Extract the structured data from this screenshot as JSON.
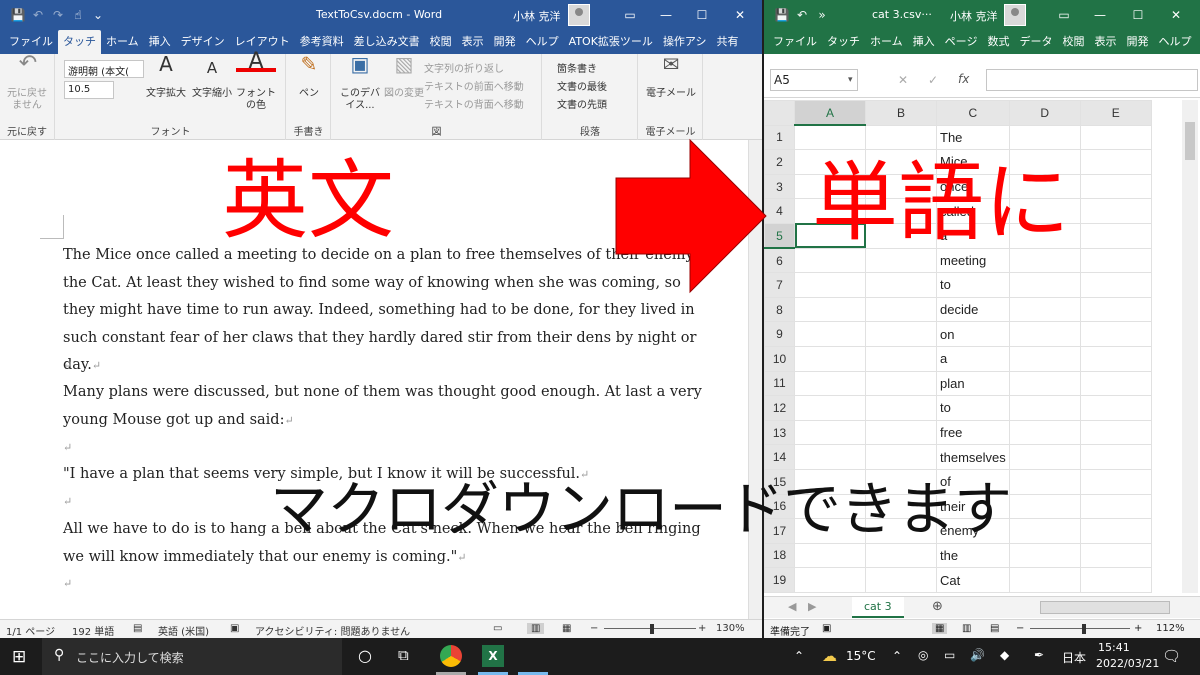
{
  "word": {
    "title": "TextToCsv.docm  -  Word",
    "user": "小林 克洋",
    "tabs": [
      "ファイル",
      "タッチ",
      "ホーム",
      "挿入",
      "デザイン",
      "レイアウト",
      "参考資料",
      "差し込み文書",
      "校閲",
      "表示",
      "開発",
      "ヘルプ",
      "ATOK拡張ツール",
      "操作アシ",
      "共有"
    ],
    "active_tab": "タッチ",
    "ribbon": {
      "undo_label": "元に戻せ\nません",
      "undo_group": "元に戻す",
      "font_name": "游明朝 (本文(",
      "font_size": "10.5",
      "grow_font": "文字拡大",
      "shrink_font": "文字縮小",
      "font_color": "フォント\nの色",
      "font_group": "フォント",
      "pen": "ペン",
      "handwriting_group": "手書き",
      "device_btn": "このデバ\nイス...",
      "change_pic": "図の変更",
      "wrap_text": "文字列の折り返し",
      "bring_front": "テキストの前面へ移動",
      "send_back": "テキストの背面へ移動",
      "picture_group": "図",
      "bullets": "箇条書き",
      "doc_end": "文書の最後",
      "doc_start": "文書の先頭",
      "paragraph_group": "段落",
      "email": "電子メール",
      "email_group": "電子メール"
    },
    "paragraphs": [
      "The Mice once called a meeting to decide on a plan to free themselves of their enemy, the Cat. At least they wished to find some way of knowing when she was coming, so they might have time to run away. Indeed, something had to be done, for they lived in such constant fear of her claws that they hardly dared stir from their dens by night or day.",
      "",
      "Many plans were discussed, but none of them was thought good enough. At last a very young Mouse got up and said:",
      "",
      "\"I have a plan that seems very simple, but I know it will be successful.",
      "",
      "All we have to do is to hang a bell about the Cat's neck. When we hear the bell ringing we will know immediately that our enemy is coming.\"",
      ""
    ],
    "status": {
      "page": "1/1 ページ",
      "words": "192 単語",
      "lang": "英語 (米国)",
      "access": "アクセシビリティ: 問題ありません",
      "zoom": "130%"
    }
  },
  "excel": {
    "title": "cat 3.csv···",
    "user": "小林 克洋",
    "tabs": [
      "ファイル",
      "タッチ",
      "ホーム",
      "挿入",
      "ページ",
      "数式",
      "データ",
      "校閲",
      "表示",
      "開発",
      "ヘルプ",
      "操作ア"
    ],
    "name_box": "A5",
    "columns": [
      "A",
      "B",
      "C",
      "D",
      "E"
    ],
    "rows": [
      {
        "n": "1",
        "c": "The"
      },
      {
        "n": "2",
        "c": "Mice"
      },
      {
        "n": "3",
        "c": "once"
      },
      {
        "n": "4",
        "c": "called"
      },
      {
        "n": "5",
        "c": "a"
      },
      {
        "n": "6",
        "c": "meeting"
      },
      {
        "n": "7",
        "c": "to"
      },
      {
        "n": "8",
        "c": "decide"
      },
      {
        "n": "9",
        "c": "on"
      },
      {
        "n": "10",
        "c": "a"
      },
      {
        "n": "11",
        "c": "plan"
      },
      {
        "n": "12",
        "c": "to"
      },
      {
        "n": "13",
        "c": "free"
      },
      {
        "n": "14",
        "c": "themselves"
      },
      {
        "n": "15",
        "c": "of"
      },
      {
        "n": "16",
        "c": "their"
      },
      {
        "n": "17",
        "c": "enemy"
      },
      {
        "n": "18",
        "c": "the"
      },
      {
        "n": "19",
        "c": "Cat"
      }
    ],
    "sheet_tab": "cat 3",
    "status_ready": "準備完了",
    "zoom": "112%"
  },
  "overlay": {
    "eibun": "英文",
    "tango": "単語に",
    "macro": "マクロダウンロードできます",
    "arrow_color": "#ff0000"
  },
  "taskbar": {
    "search": "ここに入力して検索",
    "weather": "15°C",
    "ime": "日本",
    "time": "15:41",
    "date": "2022/03/21"
  }
}
